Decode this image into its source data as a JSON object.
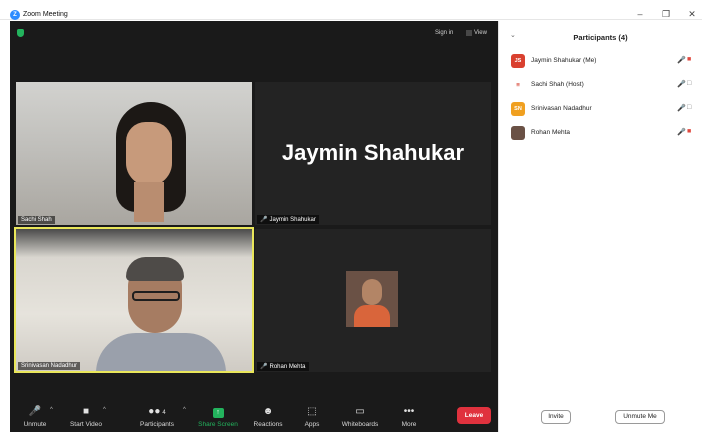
{
  "window": {
    "title": "Zoom Meeting",
    "app_icon": "zoom-icon",
    "controls": [
      "minimize",
      "restore",
      "close"
    ]
  },
  "top_bar": {
    "sign_in": "Sign in",
    "view": "View",
    "security_icon": "shield-icon"
  },
  "tiles": [
    {
      "name": "Sachi Shah",
      "muted": false,
      "video": true
    },
    {
      "name": "Jaymin Shahukar",
      "display_name": "Jaymin Shahukar",
      "muted": true,
      "video": false
    },
    {
      "name": "Srinivasan Nadadhur",
      "muted": false,
      "video": true,
      "active_speaker": true
    },
    {
      "name": "Rohan Mehta",
      "muted": true,
      "video": false
    }
  ],
  "toolbar": {
    "unmute": "Unmute",
    "start_video": "Start Video",
    "participants": "Participants",
    "participants_count": "4",
    "share_screen": "Share Screen",
    "reactions": "Reactions",
    "apps": "Apps",
    "whiteboards": "Whiteboards",
    "more": "More",
    "leave": "Leave"
  },
  "participants_panel": {
    "title": "Participants (4)",
    "items": [
      {
        "name": "Jaymin Shahukar (Me)",
        "initials": "JS",
        "avatar_color": "#d9402f",
        "mic": "muted",
        "camera": "off"
      },
      {
        "name": "Sachi Shah (Host)",
        "avatar": "logo",
        "mic": "on",
        "camera": "on"
      },
      {
        "name": "Srinivasan Nadadhur",
        "initials": "SN",
        "avatar_color": "#f0a020",
        "mic": "talking",
        "camera": "on"
      },
      {
        "name": "Rohan Mehta",
        "avatar": "photo",
        "mic": "muted",
        "camera": "off"
      }
    ],
    "invite": "Invite",
    "unmute_me": "Unmute Me"
  },
  "colors": {
    "meeting_bg": "#1a1a1a",
    "active_speaker_border": "#e9e65a",
    "leave": "#e0323e",
    "share_green": "#23b35d",
    "muted_red": "#e0483e"
  }
}
